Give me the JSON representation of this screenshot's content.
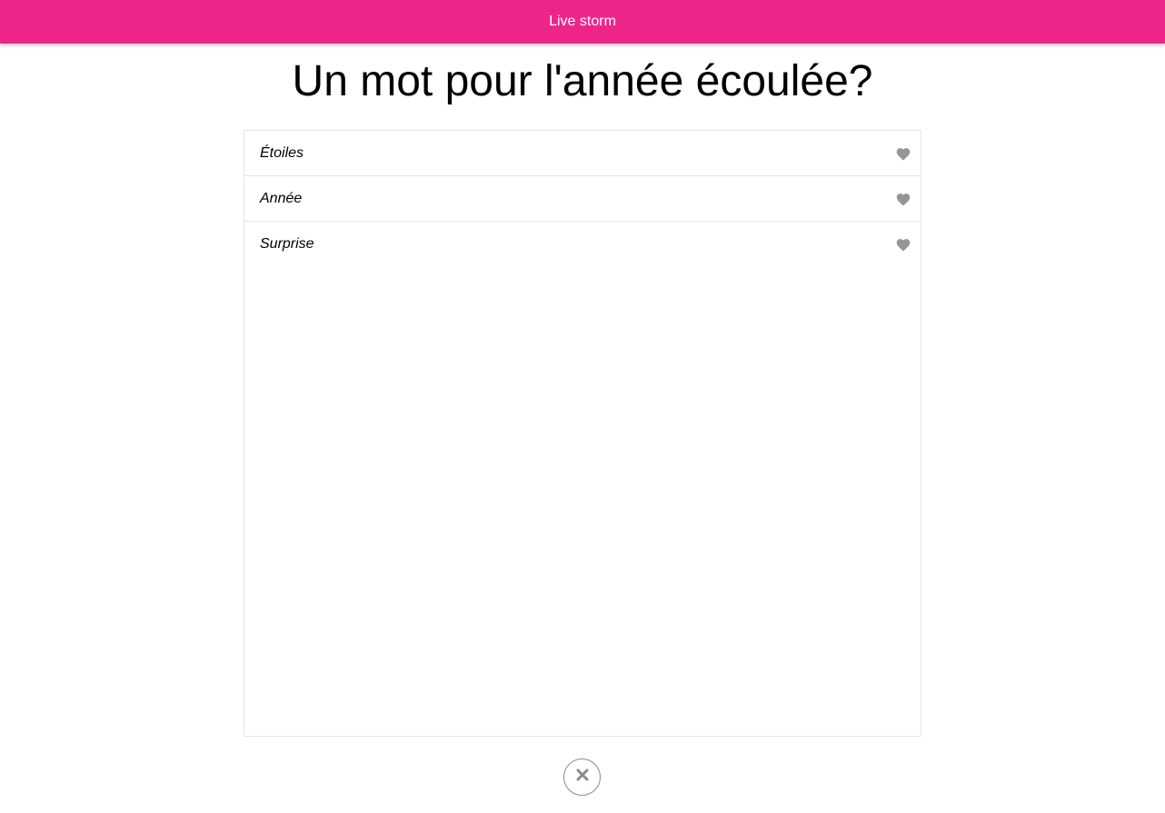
{
  "header": {
    "title": "Live storm",
    "color": "#ee2588"
  },
  "question": {
    "text": "Un mot pour l'année écoulée?"
  },
  "words": [
    {
      "label": "Étoiles",
      "icon": "heart-icon"
    },
    {
      "label": "Année",
      "icon": "heart-icon"
    },
    {
      "label": "Surprise",
      "icon": "heart-icon"
    }
  ],
  "close_button": {
    "icon": "close-icon"
  }
}
